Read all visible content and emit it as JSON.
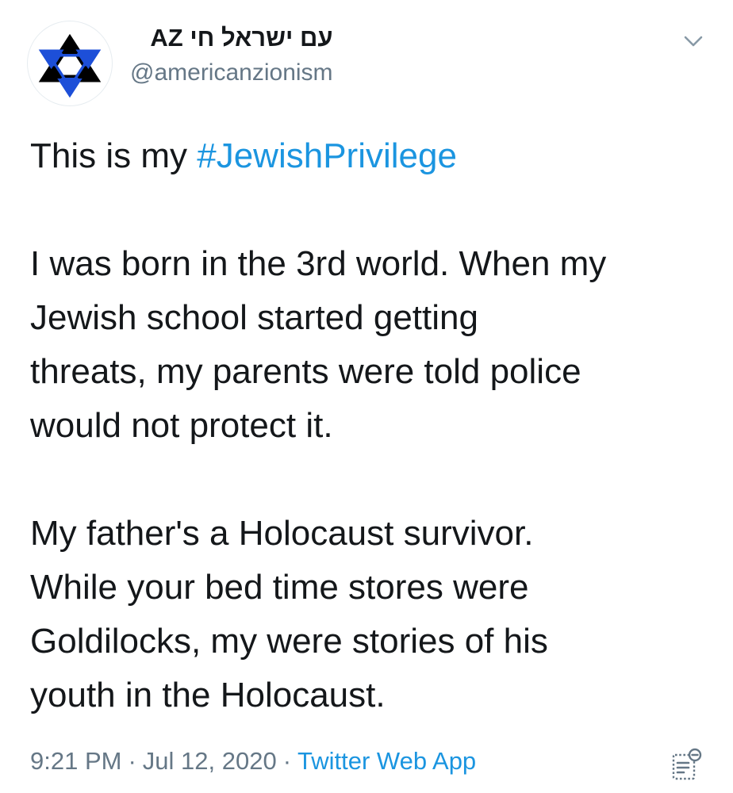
{
  "tweet": {
    "display_name": "עם ישראל חי AZ",
    "handle": "@americanzionism",
    "avatar_icon": "star-of-david-icon",
    "menu_icon": "chevron-down-icon",
    "line1_prefix": "This is my ",
    "hashtag": "#JewishPrivilege",
    "paragraph2": "I was born in the 3rd world. When my\nJewish school started getting\nthreats, my parents were told police\nwould not protect it.",
    "paragraph3": "My father's a Holocaust survivor.\nWhile your bed time stores were\nGoldilocks, my were stories of his\nyouth in the Holocaust.",
    "time": "9:21 PM",
    "date": "Jul 12, 2020",
    "separator": "·",
    "source": "Twitter Web App",
    "analytics_icon": "tweet-analytics-icon"
  },
  "colors": {
    "link": "#1b95e0",
    "text": "#14171a",
    "muted": "#657786",
    "star_blue": "#1d4fd8",
    "star_black": "#000000"
  }
}
